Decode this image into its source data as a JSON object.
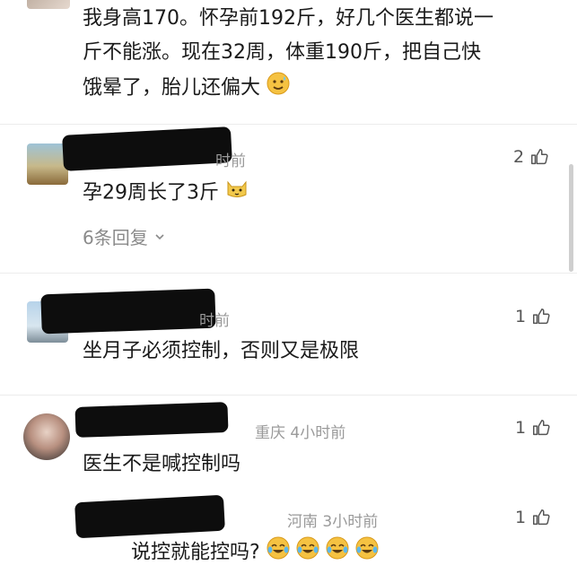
{
  "comment1": {
    "lines": [
      "我身高170。怀孕前192斤，好几个医生都说一",
      "斤不能涨。现在32周，体重190斤，把自己快",
      "饿晕了，胎儿还偏大"
    ],
    "emoji": "sweat-smile-emoji"
  },
  "comment2": {
    "time": "时前",
    "text": "孕29周长了3斤",
    "emoji": "cat-emoji",
    "likes": "2",
    "replies": "6条回复"
  },
  "comment3": {
    "time": "时前",
    "text": "坐月子必须控制，否则又是极限",
    "likes": "1"
  },
  "comment4": {
    "location_time": "重庆 4小时前",
    "text": "医生不是喊控制吗",
    "likes": "1"
  },
  "comment5": {
    "location_time": "河南 3小时前",
    "text": "说控就能控吗?",
    "likes": "1",
    "emojis": [
      "crying-laugh-emoji",
      "crying-laugh-emoji",
      "crying-laugh-emoji",
      "crying-laugh-emoji"
    ]
  },
  "colors": {
    "text": "#1a1a1a",
    "meta": "#9a9a9a",
    "redaction": "#0d0d0d"
  }
}
